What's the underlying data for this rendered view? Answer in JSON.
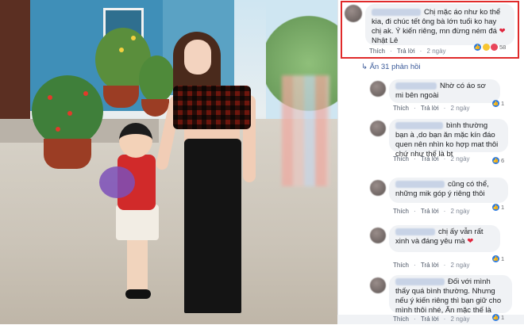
{
  "comments": [
    {
      "text": "Chị mặc áo như ko thể kia, đi chúc tết ông bà lớn tuổi ko hay chị ak. Ý kiến riêng, mn đừng ném đá",
      "tag": "Nhật Lê",
      "heart": "❤",
      "like": "Thích",
      "reply": "Trả lời",
      "time": "2 ngày",
      "reactions": "58"
    },
    {
      "text": "Nhờ có áo sơ mi bên ngoài",
      "like": "Thích",
      "reply": "Trả lời",
      "time": "2 ngày",
      "reactions": "1"
    },
    {
      "text": "bình thường bạn à ,do bạn ăn mặc kín đáo quen nên nhìn ko hợp mat thôi chứ như thế là bt",
      "like": "Thích",
      "reply": "Trả lời",
      "time": "2 ngày",
      "reactions": "6"
    },
    {
      "text": "cũng có thể, những mik góp ý riêng thôi",
      "like": "Thích",
      "reply": "Trả lời",
      "time": "2 ngày",
      "reactions": "1"
    },
    {
      "text": "chị ấy vẫn rất xinh và đáng yêu mà",
      "heart": "❤",
      "like": "Thích",
      "reply": "Trả lời",
      "time": "2 ngày",
      "reactions": "1"
    },
    {
      "text": "Đối với mình thấy quá bình thường. Nhưng nếu ý kiến riêng thì bạn giữ cho mình thôi nhé, Ăn mặc thế là quá bình thường r",
      "like": "Thích",
      "reply": "Trả lời",
      "time": "2 ngày",
      "reactions": "1"
    }
  ],
  "replies_toggle": "↳ Ẩn 31 phản hồi",
  "colors": {
    "highlight": "#e02a2a",
    "link": "#385898",
    "like_blue": "#2d7be0"
  }
}
